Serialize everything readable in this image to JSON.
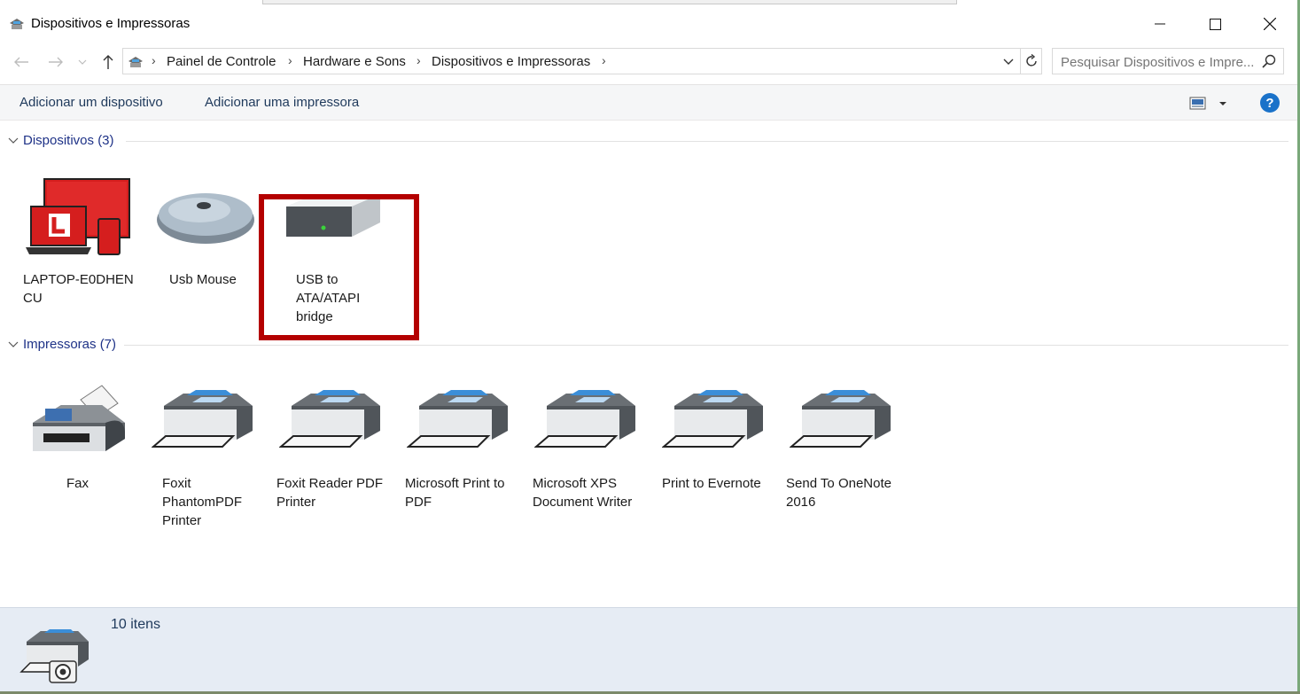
{
  "window": {
    "title": "Dispositivos e Impressoras",
    "icon": "devices-printers-icon",
    "controls": [
      "minimize-icon",
      "maximize-icon",
      "close-icon"
    ]
  },
  "navigation": {
    "back_icon": "arrow-left-icon",
    "forward_icon": "arrow-right-icon",
    "recent_icon": "chevron-down-icon",
    "up_icon": "arrow-up-icon",
    "breadcrumbs": [
      "Painel de Controle",
      "Hardware e Sons",
      "Dispositivos e Impressoras"
    ],
    "search_placeholder": "Pesquisar Dispositivos e Impre..."
  },
  "commands": {
    "add_device": "Adicionar um dispositivo",
    "add_printer": "Adicionar uma impressora",
    "help": "?"
  },
  "groups": {
    "devices": {
      "title": "Dispositivos (3)",
      "items": [
        {
          "label_lines": [
            "LAPTOP-E0DHEN",
            "CU"
          ],
          "icon": "laptop-icon"
        },
        {
          "label_lines": [
            "Usb Mouse"
          ],
          "icon": "mouse-icon"
        },
        {
          "label_lines": [
            "USB to",
            "ATA/ATAPI",
            "bridge"
          ],
          "icon": "drive-icon"
        }
      ]
    },
    "printers": {
      "title": "Impressoras (7)",
      "items": [
        {
          "label_lines": [
            "Fax"
          ],
          "icon": "fax-icon"
        },
        {
          "label_lines": [
            "Foxit",
            "PhantomPDF",
            "Printer"
          ],
          "icon": "printer-icon"
        },
        {
          "label_lines": [
            "Foxit Reader PDF",
            "Printer"
          ],
          "icon": "printer-icon"
        },
        {
          "label_lines": [
            "Microsoft Print to",
            "PDF"
          ],
          "icon": "printer-icon"
        },
        {
          "label_lines": [
            "Microsoft XPS",
            "Document Writer"
          ],
          "icon": "printer-icon"
        },
        {
          "label_lines": [
            "Print to Evernote"
          ],
          "icon": "printer-icon"
        },
        {
          "label_lines": [
            "Send To OneNote",
            "2016"
          ],
          "icon": "printer-icon"
        }
      ]
    }
  },
  "status": {
    "count": "10 itens",
    "icon": "printer-camera-icon"
  },
  "colors": {
    "highlight_box": "#b40000",
    "group_title": "#1e3287",
    "details_bg": "#e6ecf4"
  }
}
